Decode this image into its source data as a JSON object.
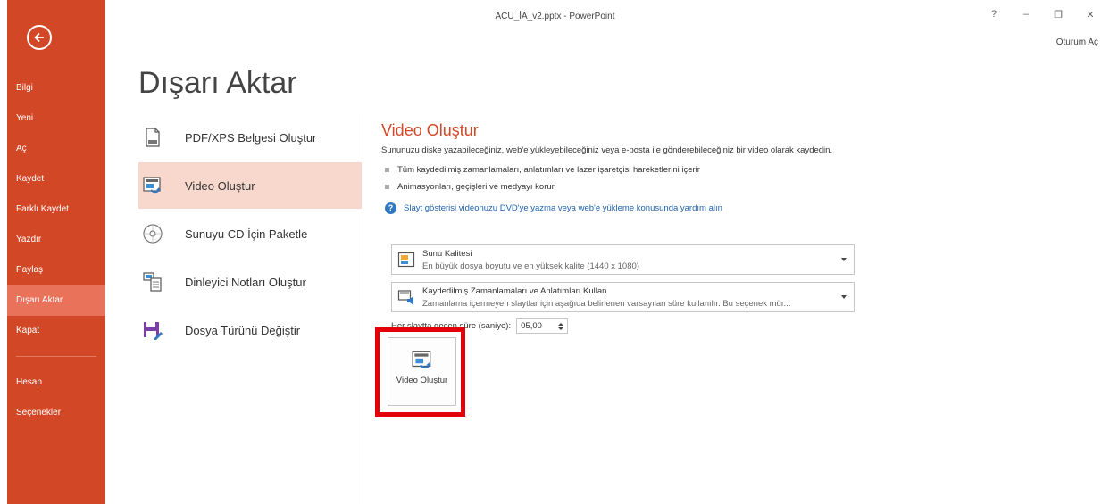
{
  "window": {
    "title": "ACU_İA_v2.pptx - PowerPoint",
    "signin": "Oturum Aç",
    "controls": [
      "?",
      "–",
      "❐",
      "✕"
    ]
  },
  "sidebar": {
    "items": [
      {
        "label": "Bilgi"
      },
      {
        "label": "Yeni"
      },
      {
        "label": "Aç"
      },
      {
        "label": "Kaydet"
      },
      {
        "label": "Farklı Kaydet"
      },
      {
        "label": "Yazdır"
      },
      {
        "label": "Paylaş"
      },
      {
        "label": "Dışarı Aktar",
        "active": true
      },
      {
        "label": "Kapat"
      },
      {
        "label": "Hesap"
      },
      {
        "label": "Seçenekler"
      }
    ]
  },
  "page": {
    "title": "Dışarı Aktar"
  },
  "options": [
    {
      "label": "PDF/XPS Belgesi Oluştur",
      "icon": "pdf-document-icon"
    },
    {
      "label": "Video Oluştur",
      "icon": "video-icon",
      "active": true
    },
    {
      "label": "Sunuyu CD İçin Paketle",
      "icon": "cd-icon"
    },
    {
      "label": "Dinleyici Notları Oluştur",
      "icon": "handout-icon"
    },
    {
      "label": "Dosya Türünü Değiştir",
      "icon": "save-as-icon"
    }
  ],
  "pane": {
    "title": "Video Oluştur",
    "description": "Sununuzu diske yazabileceğiniz, web'e yükleyebileceğiniz veya e-posta ile gönderebileceğiniz bir video olarak kaydedin.",
    "bullets": [
      "Tüm kaydedilmiş zamanlamaları, anlatımları ve lazer işaretçisi hareketlerini içerir",
      "Animasyonları, geçişleri ve medyayı korur"
    ],
    "help_link": "Slayt gösterisi videonuzu DVD'ye yazma veya web'e yükleme konusunda yardım alın",
    "quality_dropdown": {
      "main": "Sunu Kalitesi",
      "sub": "En büyük dosya boyutu ve en yüksek kalite (1440 x 1080)"
    },
    "timings_dropdown": {
      "main": "Kaydedilmiş Zamanlamaları ve Anlatımları Kullan",
      "sub": "Zamanlama içermeyen slaytlar için aşağıda belirlenen varsayılan süre kullanılır. Bu seçenek mür..."
    },
    "seconds_label": "Her slaytta geçen süre (saniye):",
    "seconds_value": "05,00",
    "create_button": "Video Oluştur"
  },
  "colors": {
    "accent": "#d24726",
    "sidebar_active": "#e8725a",
    "option_active": "#f8d8cc",
    "highlight_box": "#e3000b",
    "link": "#1e62ad"
  }
}
